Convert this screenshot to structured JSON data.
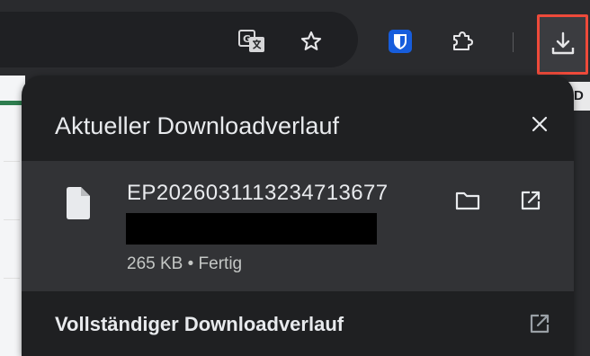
{
  "toolbar": {
    "icons": [
      "translate-icon",
      "star-icon",
      "bitwarden-icon",
      "extensions-icon",
      "download-icon"
    ],
    "tooltip": "D"
  },
  "colors": {
    "toolbar_bg": "#2a2b2e",
    "bubble_bg": "#1f2022",
    "row_bg": "#323336",
    "text": "#e8eaed",
    "highlight": "#ee4a3a",
    "bitwarden": "#175ddc"
  },
  "bubble": {
    "title": "Aktueller Downloadverlauf",
    "download": {
      "file_name": "EP2026031113234713677",
      "status": "265 KB • Fertig"
    },
    "footer_label": "Vollständiger Downloadverlauf"
  }
}
